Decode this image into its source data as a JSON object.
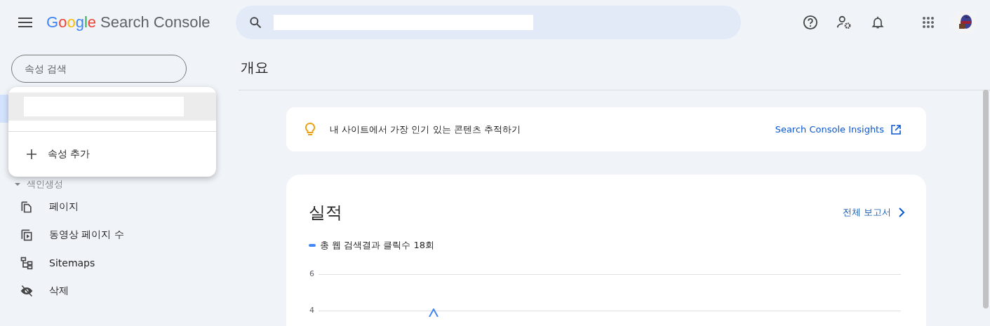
{
  "header": {
    "product": "Search Console",
    "brand_letters": [
      {
        "letter": "G",
        "color": "#4285f4"
      },
      {
        "letter": "o",
        "color": "#ea4335"
      },
      {
        "letter": "o",
        "color": "#fbbc05"
      },
      {
        "letter": "g",
        "color": "#4285f4"
      },
      {
        "letter": "l",
        "color": "#34a853"
      },
      {
        "letter": "e",
        "color": "#ea4335"
      }
    ]
  },
  "property_search": {
    "placeholder": "속성 검색"
  },
  "property_menu": {
    "add_label": "속성 추가"
  },
  "nav_sections": [
    {
      "label": "색인생성",
      "expanded": true,
      "items": [
        {
          "label": "페이지",
          "kind": "pages"
        },
        {
          "label": "동영상 페이지 수",
          "kind": "video"
        },
        {
          "label": "Sitemaps",
          "kind": "sitemaps"
        },
        {
          "label": "삭제",
          "kind": "removals"
        }
      ]
    }
  ],
  "page_title": "개요",
  "insight_banner": {
    "text": "내 사이트에서 가장 인기 있는 콘텐츠 추적하기",
    "link": "Search Console Insights"
  },
  "performance": {
    "title": "실적",
    "full_report": "전체 보고서",
    "legend": "총 웹 검색결과 클릭수 18회",
    "y_axis_labels": [
      "6",
      "4"
    ]
  }
}
